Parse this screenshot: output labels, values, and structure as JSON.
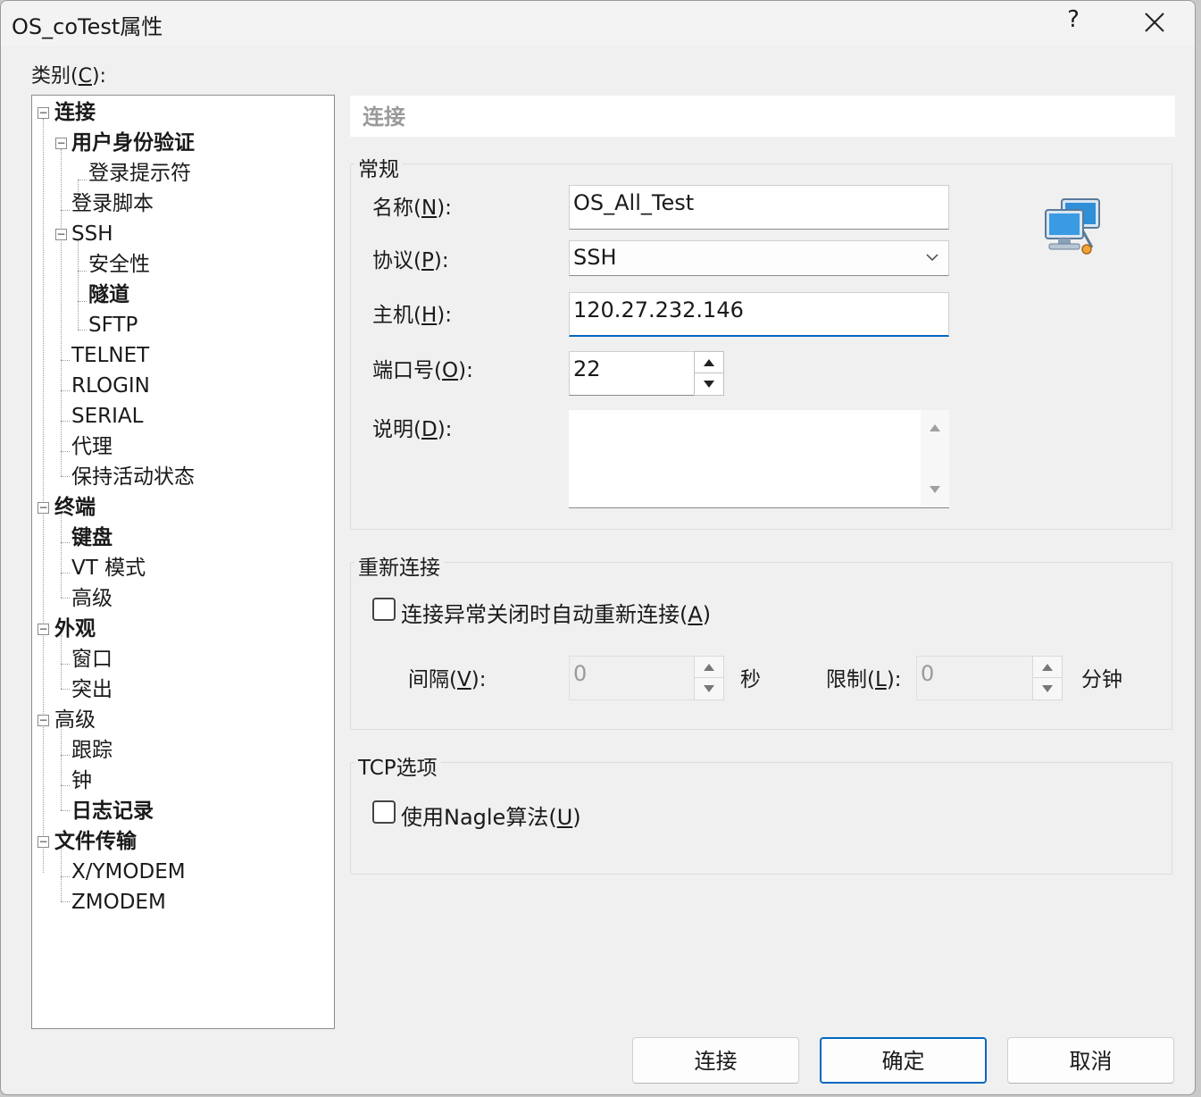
{
  "window": {
    "title": "OS_coTest属性",
    "help": "?"
  },
  "category": {
    "label": "类别(",
    "key": "C",
    "suffix": "):"
  },
  "tree": [
    {
      "label": "连接",
      "bold": true
    },
    {
      "label": "用户身份验证",
      "bold": true
    },
    {
      "label": "登录提示符",
      "bold": false
    },
    {
      "label": "登录脚本",
      "bold": false
    },
    {
      "label": "SSH",
      "bold": false
    },
    {
      "label": "安全性",
      "bold": false
    },
    {
      "label": "隧道",
      "bold": true
    },
    {
      "label": "SFTP",
      "bold": false
    },
    {
      "label": "TELNET",
      "bold": false
    },
    {
      "label": "RLOGIN",
      "bold": false
    },
    {
      "label": "SERIAL",
      "bold": false
    },
    {
      "label": "代理",
      "bold": false
    },
    {
      "label": "保持活动状态",
      "bold": false
    },
    {
      "label": "终端",
      "bold": true
    },
    {
      "label": "键盘",
      "bold": true
    },
    {
      "label": "VT 模式",
      "bold": false
    },
    {
      "label": "高级",
      "bold": false
    },
    {
      "label": "外观",
      "bold": true
    },
    {
      "label": "窗口",
      "bold": false
    },
    {
      "label": "突出",
      "bold": false
    },
    {
      "label": "高级",
      "bold": false
    },
    {
      "label": "跟踪",
      "bold": false
    },
    {
      "label": "钟",
      "bold": false
    },
    {
      "label": "日志记录",
      "bold": true
    },
    {
      "label": "文件传输",
      "bold": true
    },
    {
      "label": "X/YMODEM",
      "bold": false
    },
    {
      "label": "ZMODEM",
      "bold": false
    }
  ],
  "header": {
    "title": "连接"
  },
  "general": {
    "title": "常规",
    "name": {
      "label": "名称(",
      "key": "N",
      "suffix": "):",
      "value": "OS_All_Test"
    },
    "protocol": {
      "label": "协议(",
      "key": "P",
      "suffix": "):",
      "value": "SSH"
    },
    "host": {
      "label": "主机(",
      "key": "H",
      "suffix": "):",
      "value": "120.27.232.146"
    },
    "port": {
      "label": "端口号(",
      "key": "O",
      "suffix": "):",
      "value": "22"
    },
    "description": {
      "label": "说明(",
      "key": "D",
      "suffix": "):",
      "value": ""
    }
  },
  "reconnect": {
    "title": "重新连接",
    "auto_label": "连接异常关闭时自动重新连接(",
    "auto_key": "A",
    "auto_suffix": ")",
    "interval": {
      "label": "间隔(",
      "key": "V",
      "suffix": "):",
      "value": "0",
      "unit": "秒"
    },
    "limit": {
      "label": "限制(",
      "key": "L",
      "suffix": "):",
      "value": "0",
      "unit": "分钟"
    }
  },
  "tcp": {
    "title": "TCP选项",
    "nagle_label": "使用Nagle算法(",
    "nagle_key": "U",
    "nagle_suffix": ")"
  },
  "buttons": {
    "connect": "连接",
    "ok": "确定",
    "cancel": "取消"
  }
}
